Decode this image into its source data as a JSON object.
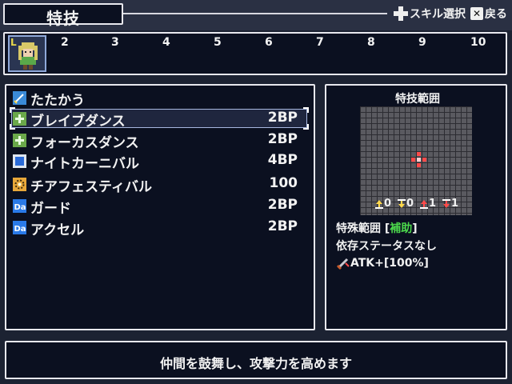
{
  "header": {
    "title": "特技",
    "hint_skill_select": "スキル選択",
    "hint_back": "戻る",
    "hint_back_button": "✕"
  },
  "party": {
    "leader_tag": "L",
    "slots": [
      "2",
      "3",
      "4",
      "5",
      "6",
      "7",
      "8",
      "9",
      "10"
    ]
  },
  "skills": [
    {
      "name": "たたかう",
      "cost": "",
      "icon": "sword-icon"
    },
    {
      "name": "ブレイブダンス",
      "cost": "2BP",
      "icon": "plus-icon"
    },
    {
      "name": "フォーカスダンス",
      "cost": "2BP",
      "icon": "plus-icon"
    },
    {
      "name": "ナイトカーニバル",
      "cost": "4BP",
      "icon": "square-icon"
    },
    {
      "name": "チアフェスティバル",
      "cost": "100",
      "icon": "burst-icon"
    },
    {
      "name": "ガード",
      "cost": "2BP",
      "icon": "da-icon"
    },
    {
      "name": "アクセル",
      "cost": "2BP",
      "icon": "da-icon"
    }
  ],
  "range": {
    "title": "特技範囲",
    "modifiers": [
      "0",
      "0",
      "1",
      "1"
    ],
    "special_label": "特殊範囲 [",
    "special_value": "補助",
    "special_close": "]",
    "dependency": "依存ステータスなし",
    "effect": "ATK+[100%]"
  },
  "message": "仲間を鼓舞し、攻撃力を高めます",
  "colors": {
    "panel_bg": "#0b1020",
    "border": "#e8e8ee",
    "accent_green": "#4cd84c",
    "range_red": "#ff4a4a"
  }
}
